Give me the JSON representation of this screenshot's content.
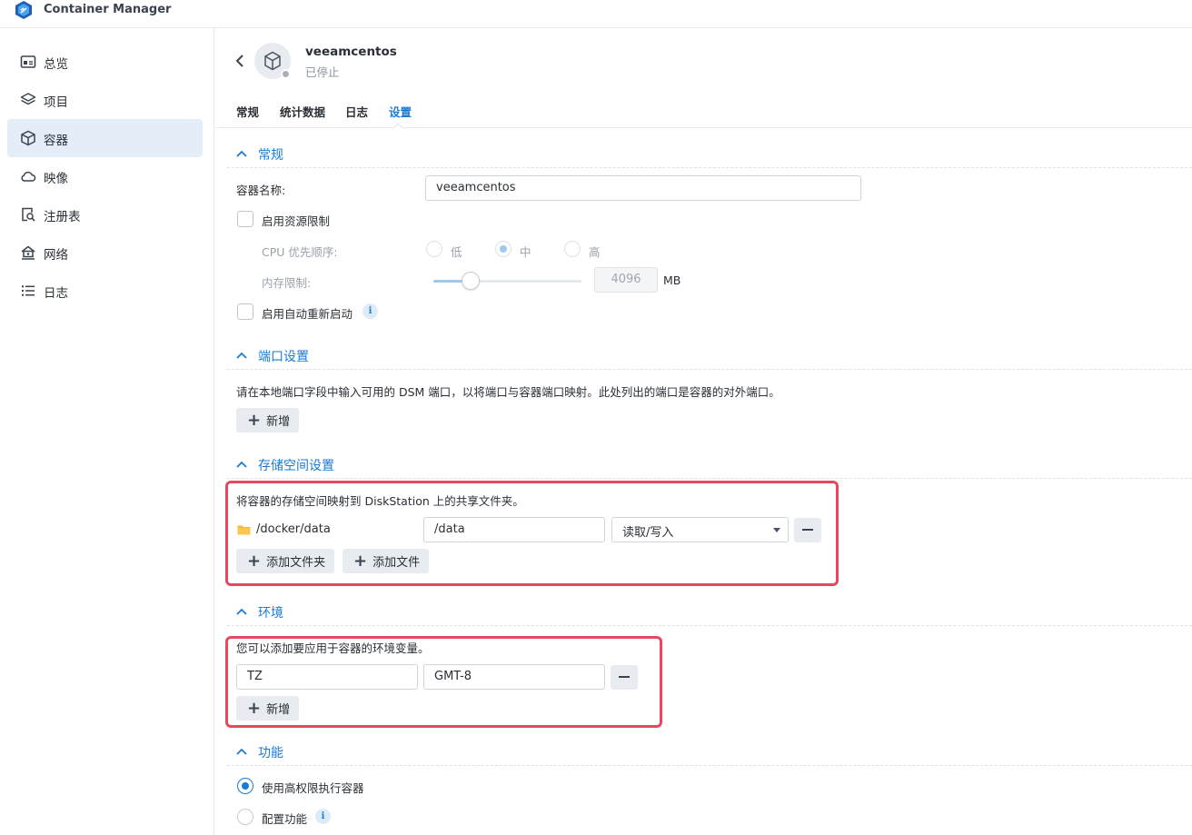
{
  "app": {
    "title": "Container Manager"
  },
  "sidebar": {
    "items": [
      {
        "label": "总览",
        "icon": "overview-icon"
      },
      {
        "label": "项目",
        "icon": "layers-icon"
      },
      {
        "label": "容器",
        "icon": "cube-icon",
        "active": true
      },
      {
        "label": "映像",
        "icon": "cloud-icon"
      },
      {
        "label": "注册表",
        "icon": "registry-search-icon"
      },
      {
        "label": "网络",
        "icon": "network-house-icon"
      },
      {
        "label": "日志",
        "icon": "list-icon"
      }
    ]
  },
  "container": {
    "name": "veeamcentos",
    "status": "已停止"
  },
  "tabs": [
    {
      "label": "常规"
    },
    {
      "label": "统计数据"
    },
    {
      "label": "日志"
    },
    {
      "label": "设置",
      "active": true
    }
  ],
  "general": {
    "title": "常规",
    "name_label": "容器名称:",
    "name_value": "veeamcentos",
    "resource_limit_label": "启用资源限制",
    "cpu_label": "CPU 优先顺序:",
    "cpu_options": [
      "低",
      "中",
      "高"
    ],
    "cpu_selected": "中",
    "memory_label": "内存限制:",
    "memory_value": "4096",
    "memory_unit": "MB",
    "memory_slider_fraction": 0.25,
    "auto_restart_label": "启用自动重新启动"
  },
  "ports": {
    "title": "端口设置",
    "description": "请在本地端口字段中输入可用的 DSM 端口，以将端口与容器端口映射。此处列出的端口是容器的对外端口。",
    "add_label": "新增"
  },
  "storage": {
    "title": "存储空间设置",
    "description": "将容器的存储空间映射到 DiskStation 上的共享文件夹。",
    "host_path": "/docker/data",
    "mount_path": "/data",
    "permission": "读取/写入",
    "add_folder_label": "添加文件夹",
    "add_file_label": "添加文件"
  },
  "environment": {
    "title": "环境",
    "description": "您可以添加要应用于容器的环境变量。",
    "var_name": "TZ",
    "var_value": "GMT-8",
    "add_label": "新增"
  },
  "capabilities": {
    "title": "功能",
    "privileged_label": "使用高权限执行容器",
    "configure_label": "配置功能"
  },
  "colors": {
    "accent": "#1a7ad4",
    "highlight_box": "#e8485e",
    "active_nav_bg": "#e3eef9"
  }
}
